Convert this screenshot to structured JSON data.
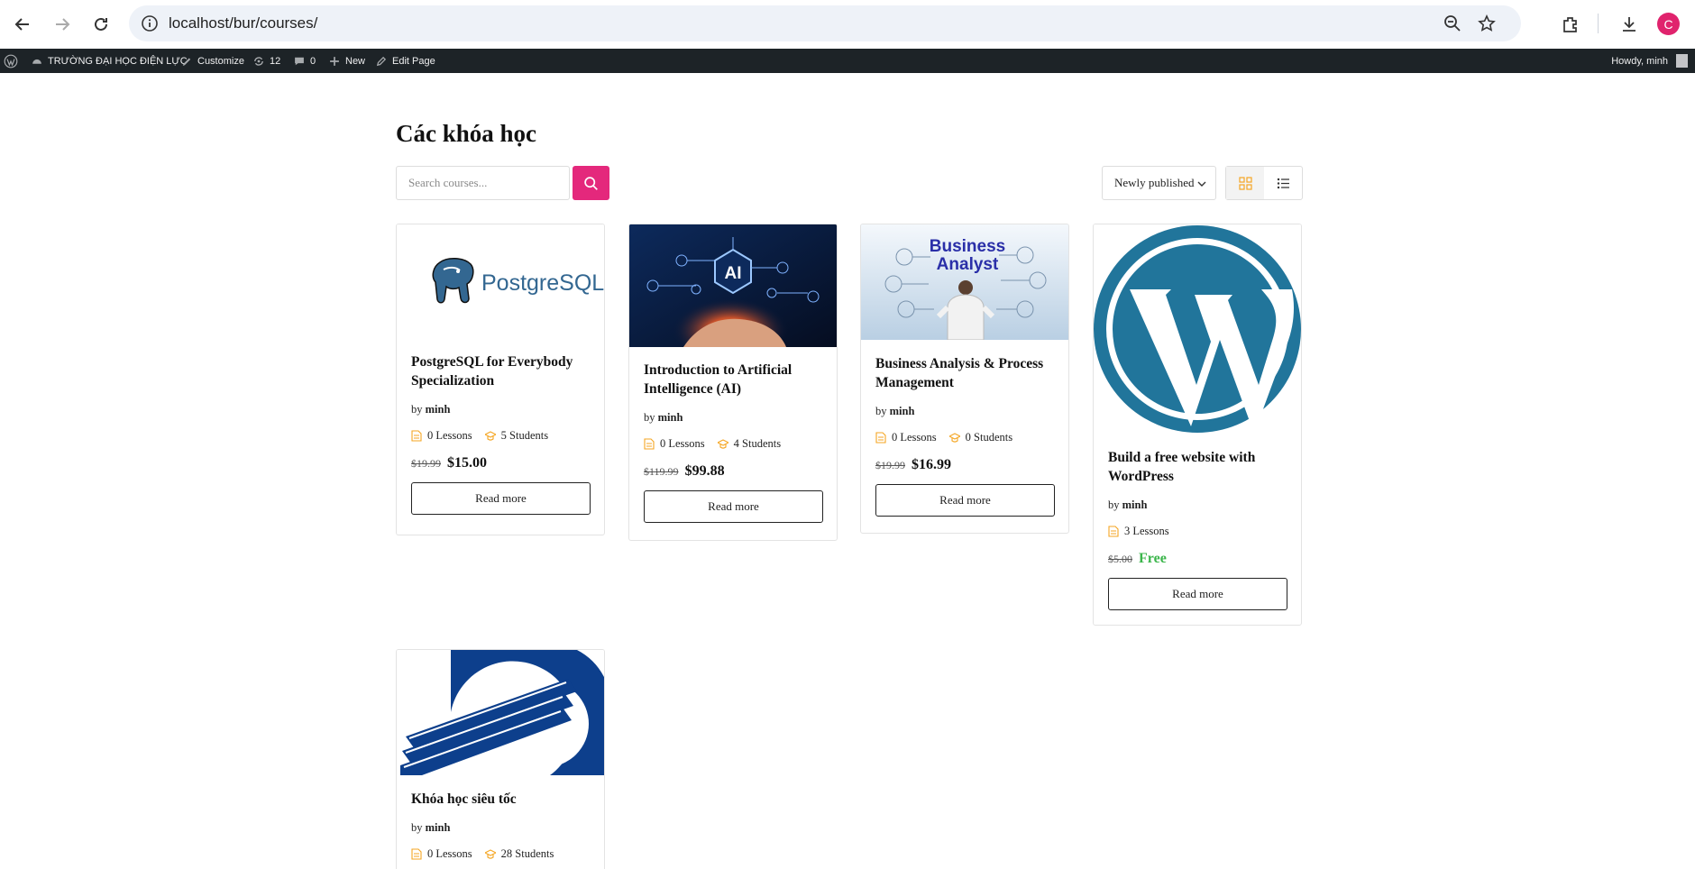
{
  "browser": {
    "url": "localhost/bur/courses/",
    "avatar_letter": "C"
  },
  "adminbar": {
    "site_name": "TRƯỜNG ĐẠI HỌC ĐIỆN LỰC",
    "customize": "Customize",
    "updates_count": "12",
    "comments_count": "0",
    "new": "New",
    "edit_page": "Edit Page",
    "howdy": "Howdy, minh"
  },
  "page": {
    "title": "Các khóa học",
    "search_placeholder": "Search courses...",
    "sort_label": "Newly published"
  },
  "colors": {
    "accent": "#e4287c",
    "icon_orange": "#f5a623",
    "free_green": "#3ab54a"
  },
  "courses": [
    {
      "title": "PostgreSQL for Everybody Specialization",
      "by": "by",
      "author": "minh",
      "lessons": "0 Lessons",
      "students": "5 Students",
      "old_price": "$19.99",
      "price": "$15.00",
      "button": "Read more"
    },
    {
      "title": "Introduction to Artificial Intelligence (AI)",
      "by": "by",
      "author": "minh",
      "lessons": "0 Lessons",
      "students": "4 Students",
      "old_price": "$119.99",
      "price": "$99.88",
      "button": "Read more"
    },
    {
      "title": "Business Analysis & Process Management",
      "by": "by",
      "author": "minh",
      "lessons": "0 Lessons",
      "students": "0 Students",
      "old_price": "$19.99",
      "price": "$16.99",
      "button": "Read more",
      "thumb_text_1": "Business",
      "thumb_text_2": "Analyst"
    },
    {
      "title": "Build a free website with WordPress",
      "by": "by",
      "author": "minh",
      "lessons": "3 Lessons",
      "old_price": "$5.00",
      "price": "Free",
      "button": "Read more"
    },
    {
      "title": "Khóa học siêu tốc",
      "by": "by",
      "author": "minh",
      "lessons": "0 Lessons",
      "students": "28 Students"
    }
  ],
  "logo_texts": {
    "postgres": "PostgreSQL",
    "ai": "AI"
  }
}
